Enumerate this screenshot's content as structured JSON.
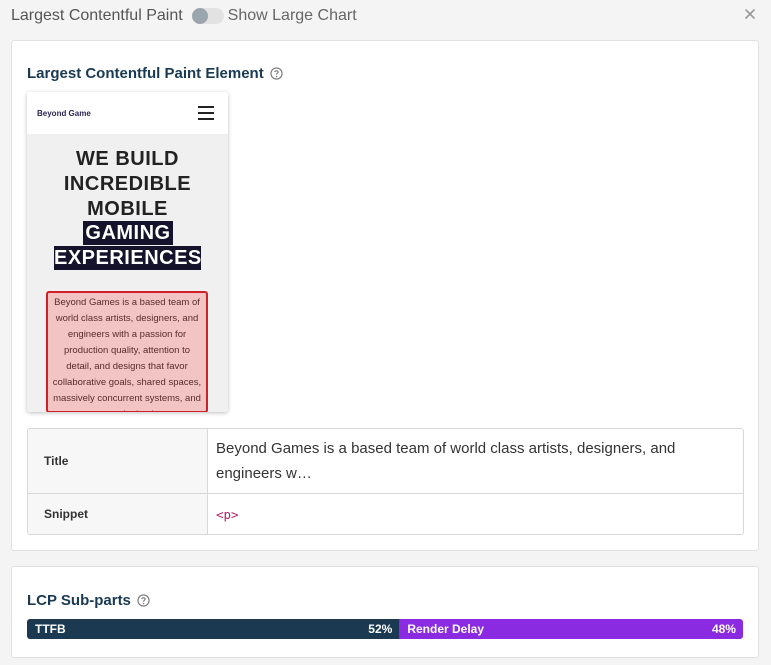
{
  "header": {
    "title": "Largest Contentful Paint",
    "toggle_label": "Show Large Chart"
  },
  "element_section": {
    "title": "Largest Contentful Paint Element",
    "preview": {
      "logo": "Beyond Game",
      "hero_lines": [
        "WE BUILD",
        "INCREDIBLE",
        "MOBILE"
      ],
      "hero_highlight_lines": [
        "GAMING",
        "EXPERIENCES"
      ],
      "lcp_text": "Beyond Games is a based team of world class artists, designers, and engineers with a passion for production quality, attention to detail, and designs that favor collaborative goals, shared spaces, massively concurrent systems, and strategic depth."
    },
    "table": {
      "title_label": "Title",
      "title_value": "Beyond Games is a based team of world class artists, designers, and engineers w…",
      "snippet_label": "Snippet",
      "snippet_value": "<p>"
    }
  },
  "subparts_section": {
    "title": "LCP Sub-parts",
    "segments": [
      {
        "label": "TTFB",
        "percent_text": "52%",
        "percent": 52,
        "color": "#1b3a52"
      },
      {
        "label": "Render Delay",
        "percent_text": "48%",
        "percent": 48,
        "color": "#8a2be2"
      }
    ]
  }
}
